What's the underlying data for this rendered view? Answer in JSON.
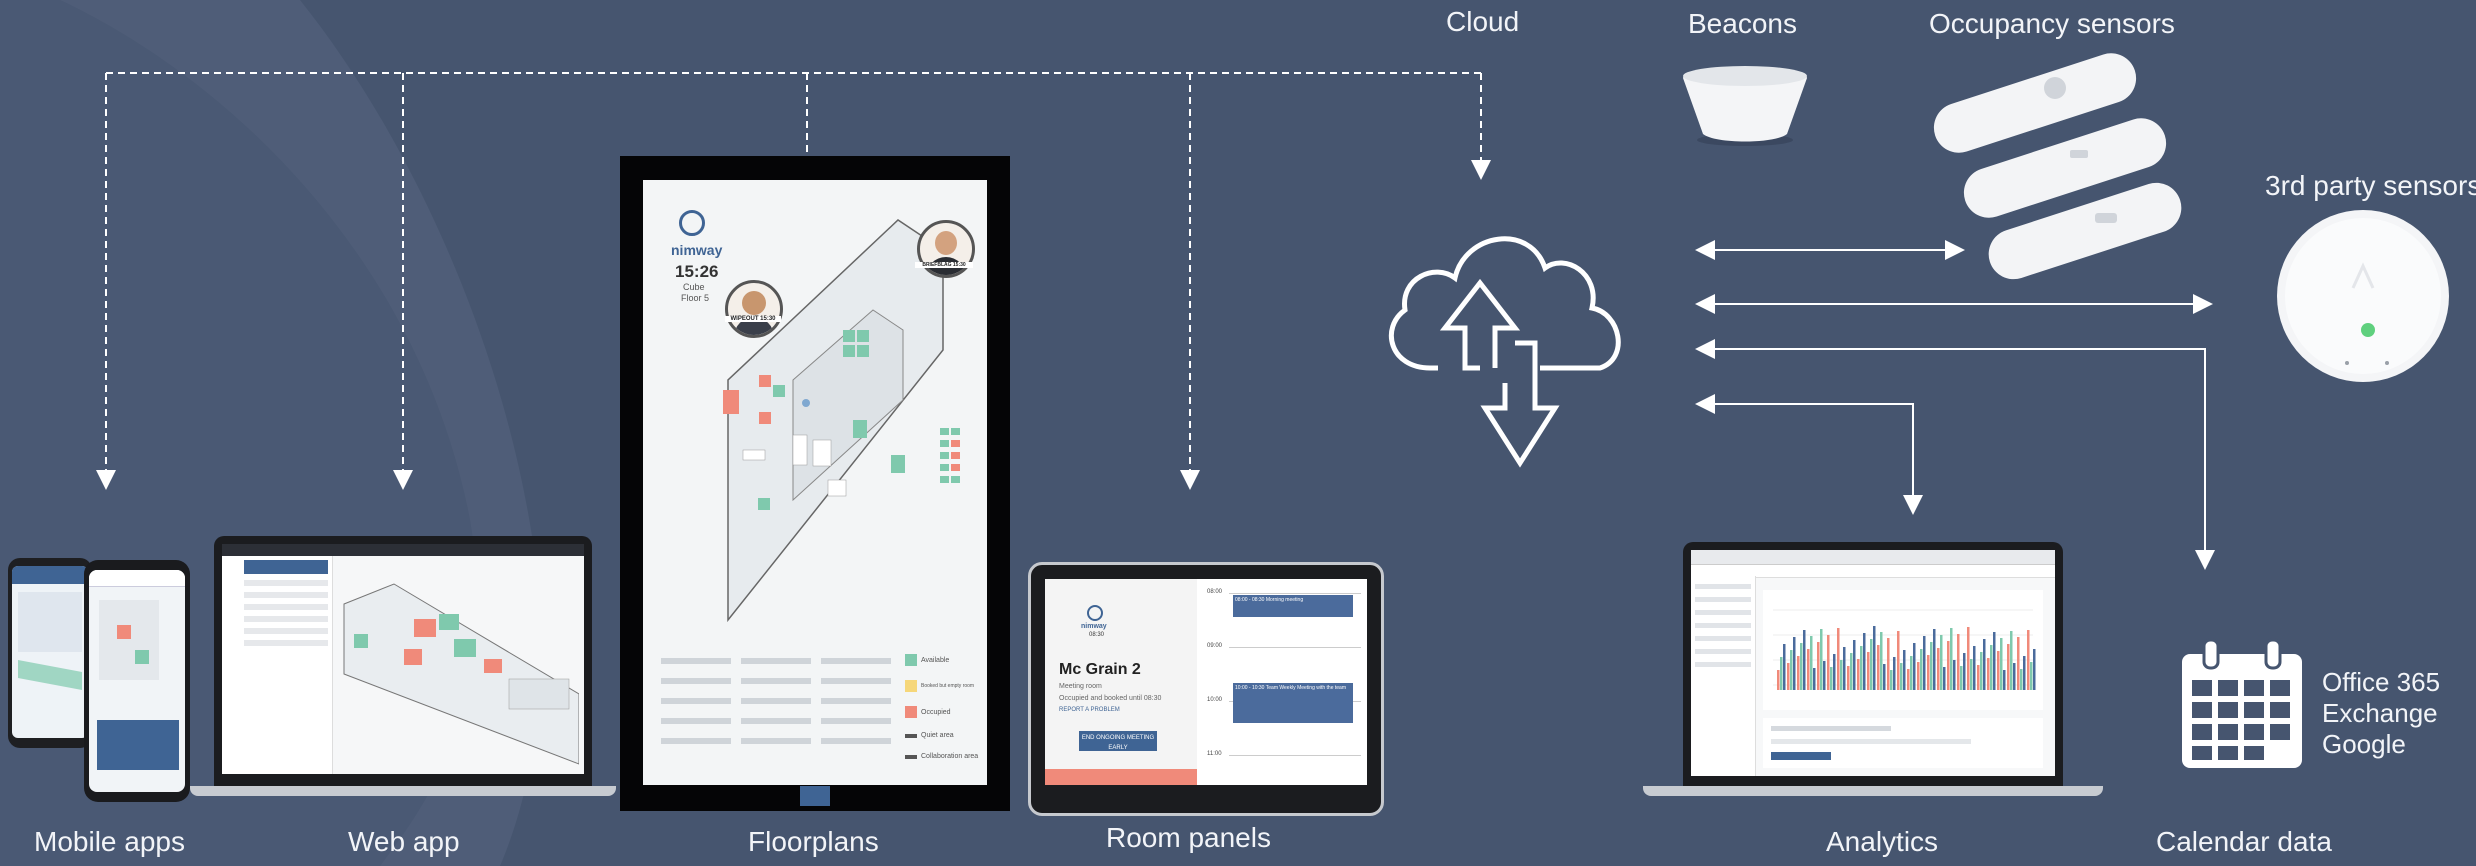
{
  "labels": {
    "mobile_apps": "Mobile apps",
    "web_app": "Web app",
    "floorplans": "Floorplans",
    "room_panels": "Room panels",
    "cloud": "Cloud",
    "beacons": "Beacons",
    "occupancy_sensors": "Occupancy sensors",
    "third_party_sensors": "3rd party sensors",
    "analytics": "Analytics",
    "calendar_data": "Calendar data"
  },
  "calendar_sources": [
    "Office 365",
    "Exchange",
    "Google"
  ],
  "floorplan_screen": {
    "brand": "nimway",
    "time": "15:26",
    "building": "Cube",
    "floor": "Floor 5",
    "badge_left": "WIPEOUT 15:30",
    "badge_right": "BRIEFBLAG 15:30",
    "legend": [
      "Available",
      "Booked but empty room",
      "Occupied",
      "Quiet area",
      "Collaboration area"
    ]
  },
  "room_panel_screen": {
    "brand": "nimway",
    "time": "08:30",
    "room": "Mc Grain 2",
    "meta": "Meeting room",
    "status": "Occupied and booked until 08:30",
    "report": "REPORT A PROBLEM",
    "button": "END ONGOING MEETING EARLY",
    "times": [
      "08:00",
      "09:00",
      "10:00",
      "11:00"
    ],
    "events": [
      "08:00 - 08:30 Morning meeting",
      "10:00 - 10:30 Team Weekly Meeting with the team"
    ]
  },
  "colors": {
    "background": "#46556f",
    "available": "#7fc9ad",
    "occupied": "#f08a7a",
    "booked": "#f6d77a",
    "accent": "#3f6494"
  }
}
